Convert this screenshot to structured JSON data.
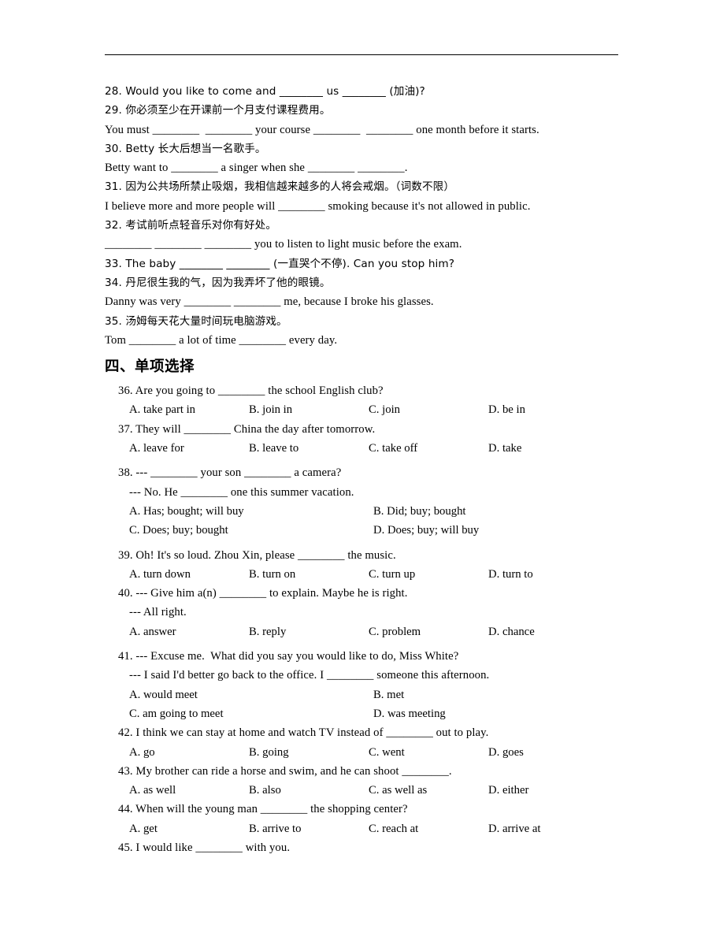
{
  "document": {
    "top_rule": true,
    "blocks": [
      {
        "type": "line",
        "style": "q",
        "text": "28. Would you like to come and ________ us ________ (加油)?"
      },
      {
        "type": "line",
        "style": "q",
        "text": "29. 你必须至少在开课前一个月支付课程费用。"
      },
      {
        "type": "line",
        "style": "q",
        "text": "You must ________  ________ your course ________  ________ one month before it starts."
      },
      {
        "type": "line",
        "style": "q",
        "text": "30. Betty 长大后想当一名歌手。"
      },
      {
        "type": "line",
        "style": "q",
        "text": "Betty want to ________ a singer when she ________ ________."
      },
      {
        "type": "line",
        "style": "q",
        "text": "31. 因为公共场所禁止吸烟，我相信越来越多的人将会戒烟。（词数不限）"
      },
      {
        "type": "line",
        "style": "q",
        "text": "I believe more and more people will ________ smoking because it's not allowed in public."
      },
      {
        "type": "line",
        "style": "q",
        "text": "32. 考试前听点轻音乐对你有好处。"
      },
      {
        "type": "line",
        "style": "q",
        "text": "________ ________ ________ you to listen to light music before the exam."
      },
      {
        "type": "line",
        "style": "q",
        "text": "33. The baby ________ ________ (一直哭个不停). Can you stop him?"
      },
      {
        "type": "line",
        "style": "q",
        "text": "34. 丹尼很生我的气，因为我弄坏了他的眼镜。"
      },
      {
        "type": "line",
        "style": "q",
        "text": "Danny was very ________ ________ me, because I broke his glasses."
      },
      {
        "type": "line",
        "style": "q",
        "text": "35. 汤姆每天花大量时间玩电脑游戏。"
      },
      {
        "type": "line",
        "style": "q",
        "text": "Tom ________ a lot of time ________ every day."
      },
      {
        "type": "heading",
        "text": "四、单项选择"
      },
      {
        "type": "line",
        "style": "q-ind",
        "text": "36. Are you going to ________ the school English club?"
      },
      {
        "type": "options4",
        "indent": 2,
        "options": [
          "A. take part in",
          "B. join in",
          "C. join",
          "D. be in"
        ]
      },
      {
        "type": "line",
        "style": "q-ind",
        "text": "37. They will ________ China the day after tomorrow."
      },
      {
        "type": "options4",
        "indent": 2,
        "options": [
          "A. leave for",
          "B. leave to",
          "C. take off",
          "D. take"
        ]
      },
      {
        "type": "gap"
      },
      {
        "type": "line",
        "style": "q-ind",
        "text": "38. --- ________ your son ________ a camera?"
      },
      {
        "type": "line",
        "style": "q-ind2",
        "text": "--- No. He ________ one this summer vacation."
      },
      {
        "type": "options2",
        "indent": 2,
        "options": [
          "A. Has; bought; will buy",
          "B. Did; buy; bought"
        ]
      },
      {
        "type": "options2",
        "indent": 2,
        "options": [
          "C. Does; buy; bought",
          "D. Does; buy; will buy"
        ]
      },
      {
        "type": "gap"
      },
      {
        "type": "line",
        "style": "q-ind",
        "text": "39. Oh! It's so loud. Zhou Xin, please ________ the music."
      },
      {
        "type": "options4",
        "indent": 2,
        "options": [
          "A. turn down",
          "B. turn on",
          "C. turn up",
          "D. turn to"
        ]
      },
      {
        "type": "line",
        "style": "q-ind",
        "text": "40. --- Give him a(n) ________ to explain. Maybe he is right."
      },
      {
        "type": "line",
        "style": "q-ind2",
        "text": "--- All right."
      },
      {
        "type": "options4",
        "indent": 2,
        "options": [
          "A. answer",
          "B. reply",
          "C. problem",
          "D. chance"
        ]
      },
      {
        "type": "gap"
      },
      {
        "type": "line",
        "style": "q-ind",
        "text": "41. --- Excuse me.  What did you say you would like to do, Miss White?"
      },
      {
        "type": "line",
        "style": "q-ind2",
        "text": "--- I said I'd better go back to the office. I ________ someone this afternoon."
      },
      {
        "type": "options2",
        "indent": 2,
        "options": [
          "A. would meet",
          "B. met"
        ]
      },
      {
        "type": "options2",
        "indent": 2,
        "options": [
          "C. am going to meet",
          "D. was meeting"
        ]
      },
      {
        "type": "line",
        "style": "q-ind",
        "text": "42. I think we can stay at home and watch TV instead of ________ out to play."
      },
      {
        "type": "options4",
        "indent": 2,
        "options": [
          "A. go",
          "B. going",
          "C. went",
          "D. goes"
        ]
      },
      {
        "type": "line",
        "style": "q-ind",
        "text": "43. My brother can ride a horse and swim, and he can shoot ________."
      },
      {
        "type": "options4",
        "indent": 2,
        "options": [
          "A. as well",
          "B. also",
          "C. as well as",
          "D. either"
        ]
      },
      {
        "type": "line",
        "style": "q-ind",
        "text": "44. When will the young man ________ the shopping center?"
      },
      {
        "type": "options4",
        "indent": 2,
        "options": [
          "A. get",
          "B. arrive to",
          "C. reach at",
          "D. arrive at"
        ]
      },
      {
        "type": "line",
        "style": "q-ind",
        "text": "45. I would like ________ with you."
      }
    ]
  }
}
